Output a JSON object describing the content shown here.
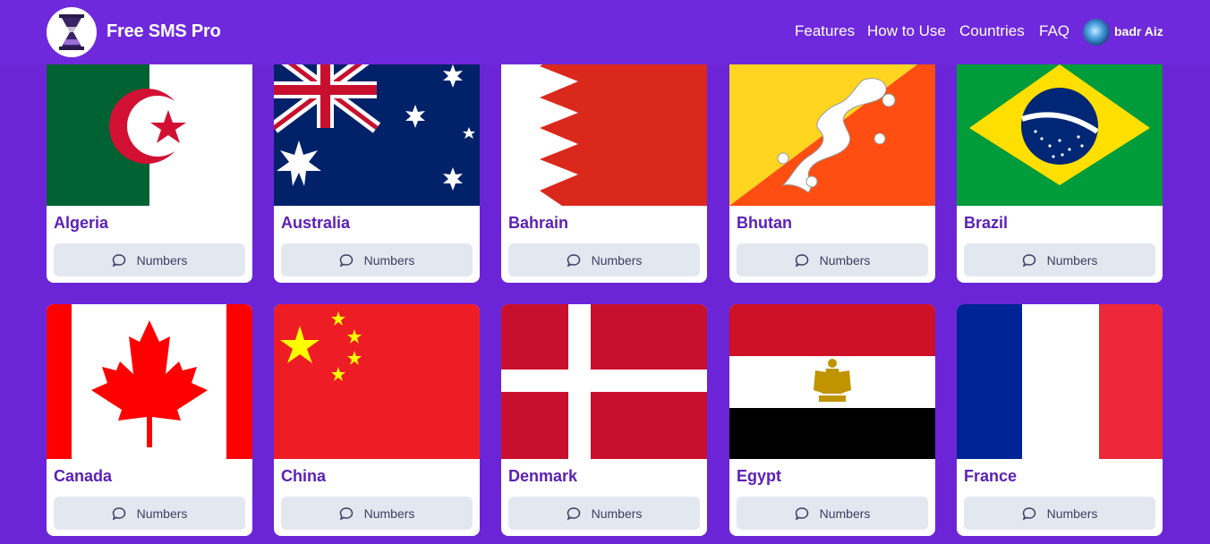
{
  "header": {
    "brand": "Free SMS Pro",
    "logo_icon": "hourglass-logo-icon",
    "nav": [
      "Features",
      "How to Use",
      "Countries",
      "FAQ"
    ],
    "user": {
      "name": "badr Aiz",
      "avatar_icon": "user-avatar"
    }
  },
  "colors": {
    "background": "#6b25d6",
    "title": "#5b21b6",
    "button_bg": "#e3e8f0"
  },
  "countries": [
    {
      "name": "Algeria",
      "button": "Numbers",
      "icon": "chat-bubble-icon"
    },
    {
      "name": "Australia",
      "button": "Numbers",
      "icon": "chat-bubble-icon"
    },
    {
      "name": "Bahrain",
      "button": "Numbers",
      "icon": "chat-bubble-icon"
    },
    {
      "name": "Bhutan",
      "button": "Numbers",
      "icon": "chat-bubble-icon"
    },
    {
      "name": "Brazil",
      "button": "Numbers",
      "icon": "chat-bubble-icon"
    },
    {
      "name": "Canada",
      "button": "Numbers",
      "icon": "chat-bubble-icon"
    },
    {
      "name": "China",
      "button": "Numbers",
      "icon": "chat-bubble-icon"
    },
    {
      "name": "Denmark",
      "button": "Numbers",
      "icon": "chat-bubble-icon"
    },
    {
      "name": "Egypt",
      "button": "Numbers",
      "icon": "chat-bubble-icon"
    },
    {
      "name": "France",
      "button": "Numbers",
      "icon": "chat-bubble-icon"
    }
  ]
}
